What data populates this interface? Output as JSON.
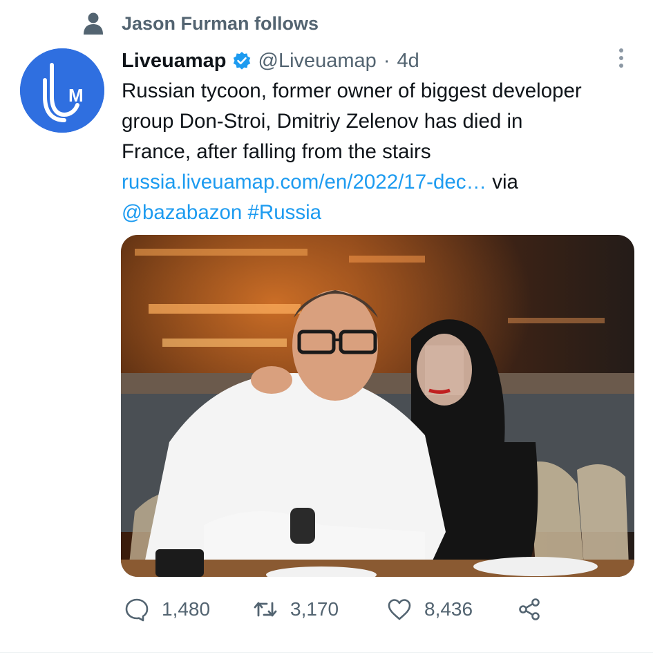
{
  "social_context": {
    "text": "Jason Furman follows",
    "icon": "person-icon"
  },
  "author": {
    "display_name": "Liveuamap",
    "handle": "@Liveuamap",
    "separator": "·",
    "time": "4d",
    "verified": true,
    "avatar_text": "UM",
    "avatar_color": "#2f6fe0"
  },
  "tweet": {
    "text_line_1": "Russian tycoon, former owner of biggest developer",
    "text_line_2": "group Don-Stroi, Dmitriy Zelenov has died in",
    "text_line_3": "France, after falling from the stairs",
    "link": "russia.liveuamap.com/en/2022/17-dec…",
    "via": " via",
    "mention": "@bazabazon",
    "hashtag": "#Russia"
  },
  "media": {
    "kind": "photo",
    "alt": "photo"
  },
  "actions": {
    "reply_count": "1,480",
    "retweet_count": "3,170",
    "like_count": "8,436"
  },
  "colors": {
    "accent": "#1d9bf0",
    "secondary_text": "#536471",
    "primary_text": "#0f1419"
  }
}
